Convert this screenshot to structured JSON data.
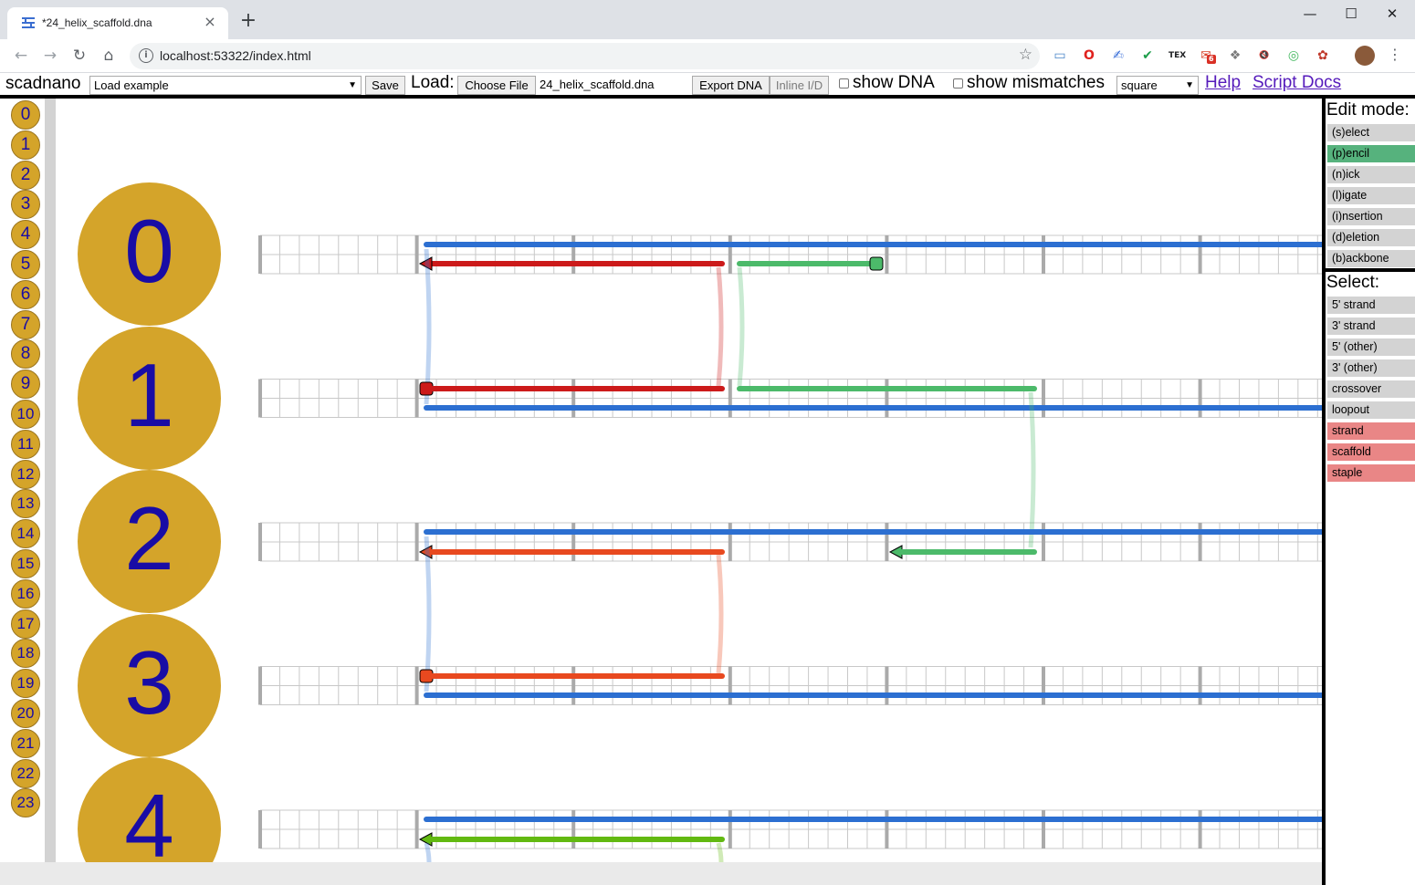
{
  "browser": {
    "tab_title": "*24_helix_scaffold.dna",
    "tab_close": "×",
    "new_tab": "+",
    "url": "localhost:53322/index.html",
    "window_controls": {
      "minimize": "—",
      "maximize": "☐",
      "close": "✕"
    },
    "nav_icons": [
      "back-icon",
      "forward-icon",
      "reload-icon",
      "home-icon"
    ],
    "extensions": [
      {
        "name": "translate-icon",
        "glyph": "▭",
        "color": "#4a86c8"
      },
      {
        "name": "opera-icon",
        "glyph": "O",
        "color": "#e0231f"
      },
      {
        "name": "signature-icon",
        "glyph": "✍",
        "color": "#3a6fd8"
      },
      {
        "name": "checkmark-icon",
        "glyph": "✔",
        "color": "#1e9e4b"
      },
      {
        "name": "tex-icon",
        "glyph": "TEX",
        "color": "#202124"
      },
      {
        "name": "mail-icon",
        "glyph": "✉",
        "color": "#d9452d",
        "badge": "6"
      },
      {
        "name": "dropbox-icon",
        "glyph": "❖",
        "color": "#7a7a7a"
      },
      {
        "name": "mute-icon",
        "glyph": "🔇",
        "color": "#202124"
      },
      {
        "name": "circle-ext-icon",
        "glyph": "◎",
        "color": "#43b85e"
      },
      {
        "name": "puzzle-ext-icon",
        "glyph": "✿",
        "color": "#c0392b"
      }
    ]
  },
  "menu": {
    "app_name": "scadnano",
    "load_example": "Load example",
    "save": "Save",
    "load_label": "Load:",
    "choose_file": "Choose File",
    "file_name": "24_helix_scaffold.dna",
    "export_dna": "Export DNA",
    "inline_id": "Inline I/D",
    "show_dna": "show DNA",
    "show_mismatches": "show mismatches",
    "grid": "square",
    "help": "Help",
    "script_docs": "Script Docs"
  },
  "side_panel": {
    "edit_heading": "Edit mode:",
    "edit_modes": [
      "(s)elect",
      "(p)encil",
      "(n)ick",
      "(l)igate",
      "(i)nsertion",
      "(d)eletion",
      "(b)ackbone"
    ],
    "active_mode": "(p)encil",
    "select_heading": "Select:",
    "select_options": [
      "5' strand",
      "3' strand",
      "5' (other)",
      "3' (other)",
      "crossover",
      "loopout",
      "strand",
      "scaffold",
      "staple"
    ],
    "highlighted_select": [
      "strand",
      "scaffold",
      "staple"
    ]
  },
  "helix_indices": [
    "0",
    "1",
    "2",
    "3",
    "4",
    "5",
    "6",
    "7",
    "8",
    "9",
    "10",
    "11",
    "12",
    "13",
    "14",
    "15",
    "16",
    "17",
    "18",
    "19",
    "20",
    "21",
    "22",
    "23"
  ],
  "helices_visible": [
    "0",
    "1",
    "2",
    "3",
    "4"
  ],
  "colors": {
    "scaffold": "#2c6fd1",
    "staple_red": "#cc1a1a",
    "staple_green": "#4cba6a",
    "staple_orange": "#e8491f",
    "staple_lime": "#62b911",
    "gold": "#d4a42a",
    "index_text": "#190ca5",
    "pencil_active": "#56b27d"
  }
}
